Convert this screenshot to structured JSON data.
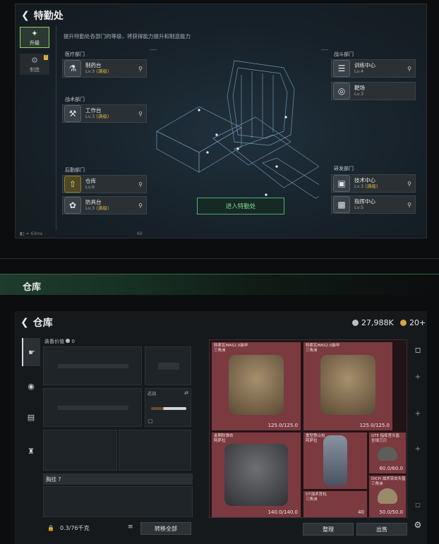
{
  "dept": {
    "title": "特勤处",
    "subtitle": "提升特勤处各部门的等级，将获得能力提升和制造能力",
    "tabs": [
      {
        "label": "升级",
        "icon": "upgrade-icon"
      },
      {
        "label": "制造",
        "icon": "craft-icon"
      }
    ],
    "sections": {
      "medical": "医疗部门",
      "tactical": "战术部门",
      "logistics": "后勤部门",
      "combat": "战斗部门",
      "research": "研发部门"
    },
    "stations": {
      "pharmacy": {
        "name": "制药台",
        "level": "Lv.3",
        "tag": "(满级)"
      },
      "workbench": {
        "name": "工作台",
        "level": "Lv.3",
        "tag": "(满级)"
      },
      "warehouse": {
        "name": "仓库",
        "level": "Lv.6"
      },
      "armorbench": {
        "name": "防具台",
        "level": "Lv.3",
        "tag": "(满级)"
      },
      "training": {
        "name": "训练中心",
        "level": "Lv.4"
      },
      "range": {
        "name": "靶场",
        "level": "Lv.3"
      },
      "techcenter": {
        "name": "技术中心",
        "level": "Lv.3",
        "tag": "(满级)"
      },
      "command": {
        "name": "指挥中心",
        "level": "Lv.5"
      }
    },
    "enter_button": "进入特勤处",
    "status": {
      "ping": "63ms",
      "fps": "60"
    }
  },
  "banner": {
    "title": "仓库"
  },
  "warehouse": {
    "title": "仓库",
    "currency1": "27,988K",
    "currency2": "20+",
    "equip_value_label": "装备价值",
    "equip_value": "0",
    "melee_label": "近战",
    "backpack_label": "胸挂",
    "backpack_q": "?",
    "capacity": "0.3/76千克",
    "transfer_all": "转移全部",
    "sort": "整理",
    "sell": "出售",
    "items": [
      {
        "name": "特索瓦MAS2.0装甲",
        "sub": "三角洲",
        "durability": "125.0/125.0"
      },
      {
        "name": "特索瓦MAS2.0装甲",
        "sub": "三角洲",
        "durability": "125.0/125.0"
      },
      {
        "name": "金刚防弹衣",
        "sub": "阿萨拉",
        "durability": "140.0/140.0"
      },
      {
        "name": "重型登山包",
        "sub": "阿萨拉",
        "durability": ""
      },
      {
        "name": "GT5 指挥官头盔",
        "sub": "全球刀刃",
        "durability": "60.0/60.0"
      },
      {
        "name": "DICH 战术突击头盔",
        "sub": "三角洲",
        "durability": "50.0/50.0"
      },
      {
        "name": "DT战术背包",
        "sub": "三角洲",
        "durability": "40"
      }
    ]
  }
}
